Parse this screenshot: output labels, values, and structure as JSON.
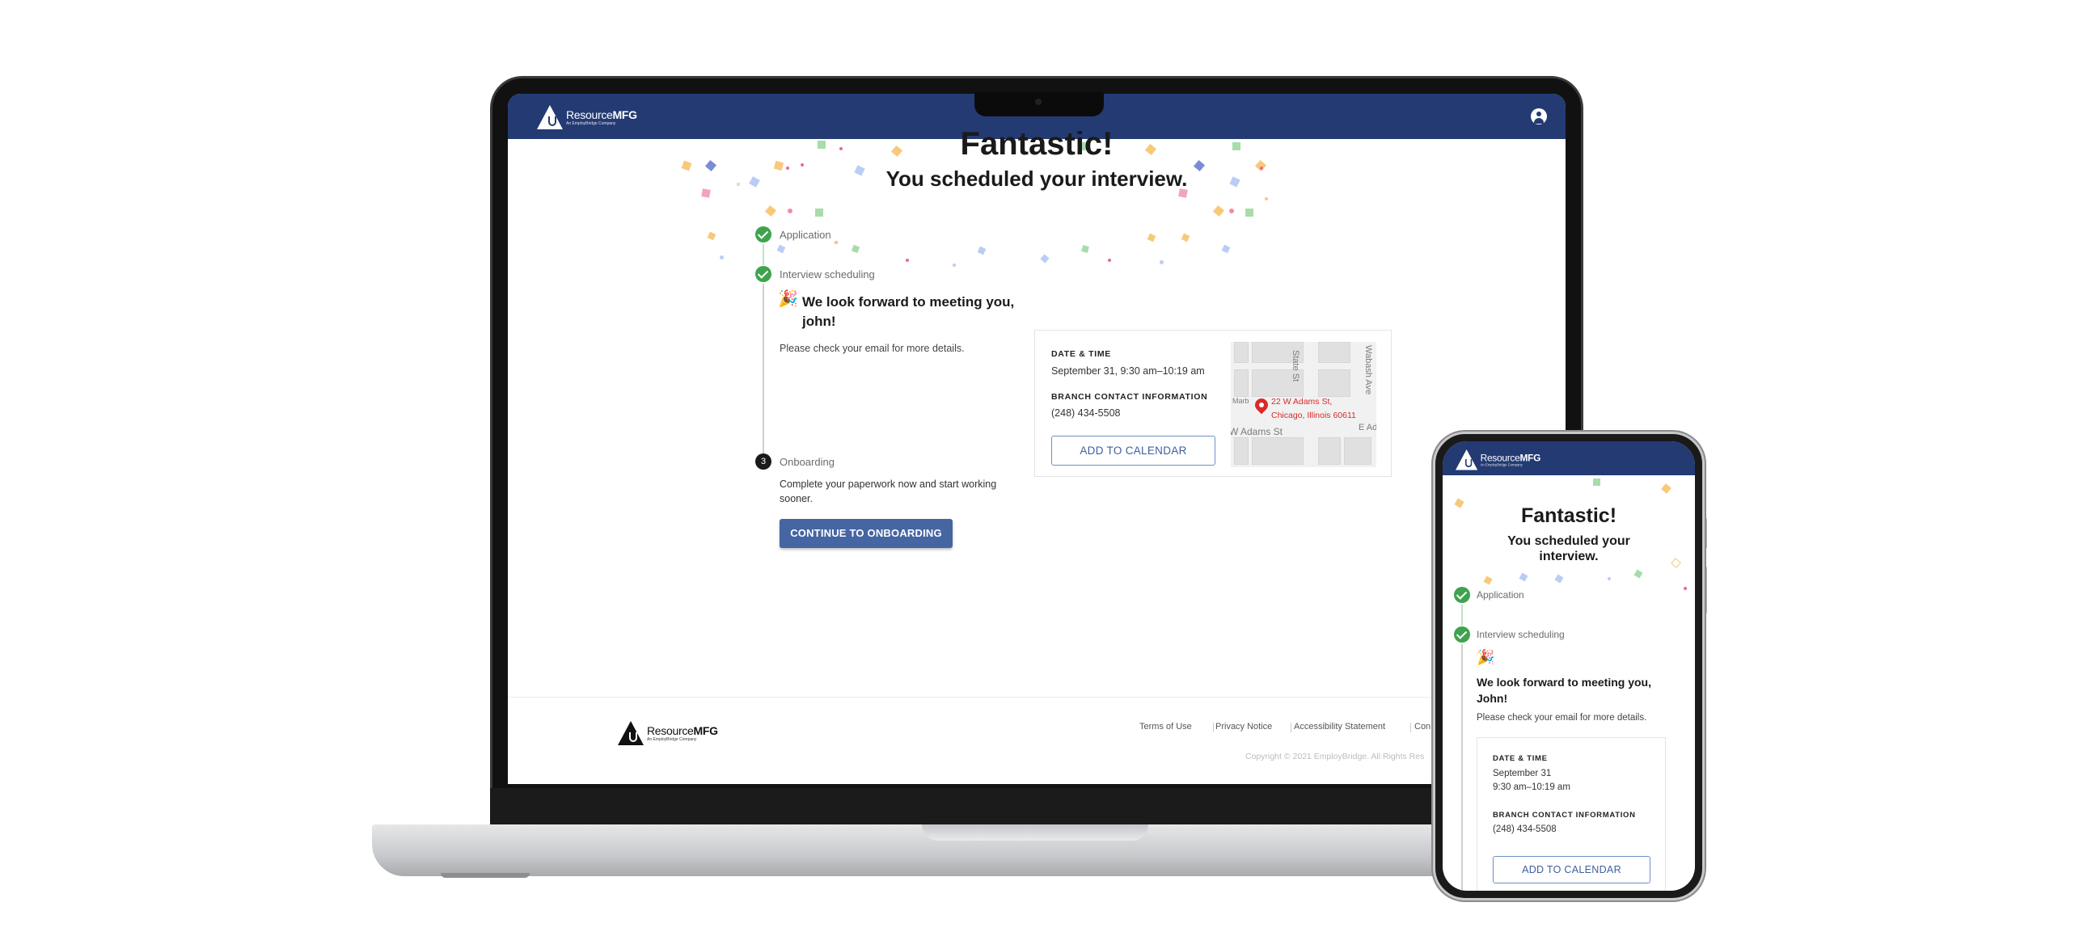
{
  "brand": {
    "name_light": "Resource",
    "name_bold": "MFG",
    "tagline": "An EmployBridge Company"
  },
  "hero": {
    "title": "Fantastic!",
    "subtitle": "You scheduled your interview.",
    "subtitle_line1": "You scheduled your",
    "subtitle_line2": "interview."
  },
  "steps": {
    "application": {
      "label": "Application",
      "status": "complete"
    },
    "interview": {
      "label": "Interview scheduling",
      "status": "complete",
      "heading": "We look forward to meeting you, john!",
      "heading_line1": "We look forward to meeting you,",
      "heading_line2": "john!",
      "heading_mobile_line1": "We look forward to meeting you,",
      "heading_mobile_line2": "John!",
      "body": "Please check your email for more details."
    },
    "onboarding": {
      "number": "3",
      "label": "Onboarding",
      "body_line1": "Complete your paperwork now and start working",
      "body_line2": "sooner.",
      "cta": "CONTINUE TO ONBOARDING"
    }
  },
  "appointment": {
    "date_time_label": "DATE & TIME",
    "date_time_value": "September 31, 9:30 am–10:19 am",
    "date_mobile": "September 31",
    "time_mobile": "9:30 am–10:19 am",
    "branch_label": "BRANCH CONTACT INFORMATION",
    "branch_phone": "(248) 434-5508",
    "add_to_calendar": "ADD TO CALENDAR"
  },
  "map": {
    "address_line1": "22 W Adams St,",
    "address_line2": "Chicago, Illinois 60611",
    "streets": [
      "State St",
      "Wabash Ave",
      "W Adams St",
      "E Ad",
      "Marb"
    ]
  },
  "footer": {
    "links": [
      "Terms of Use",
      "Privacy Notice",
      "Accessibility Statement",
      "Con"
    ],
    "copyright": "Copyright © 2021 EmployBridge. All Rights Res"
  },
  "icons": {
    "account": "account-circle-icon",
    "check": "check-icon",
    "party": "party-popper-icon",
    "pin": "map-pin-icon"
  },
  "colors": {
    "header": "#233a73",
    "primary_button": "#4565a3",
    "success": "#3fa34d",
    "pin": "#d92a2a"
  }
}
